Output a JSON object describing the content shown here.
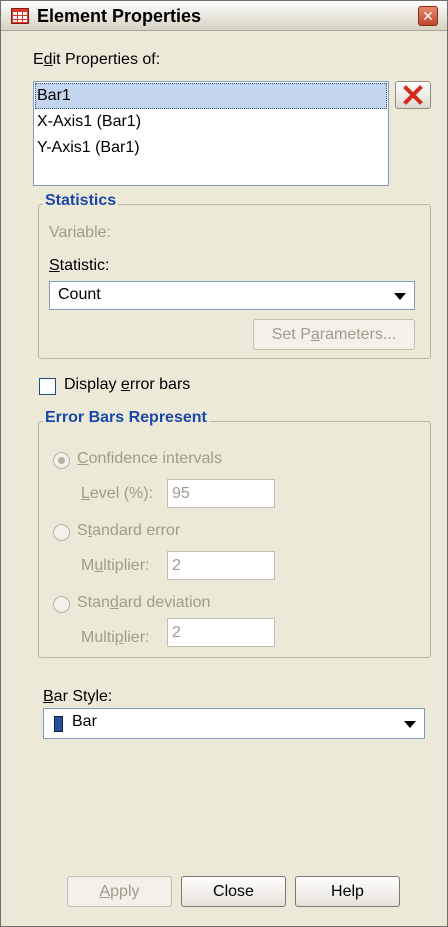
{
  "window": {
    "title": "Element Properties"
  },
  "edit_properties": {
    "label_pre": "E",
    "label_u": "d",
    "label_post": "it Properties of:",
    "items": [
      {
        "label": "Bar1",
        "selected": true
      },
      {
        "label": "X-Axis1 (Bar1)",
        "selected": false
      },
      {
        "label": "Y-Axis1 (Bar1)",
        "selected": false
      }
    ]
  },
  "statistics": {
    "group_title": "Statistics",
    "variable_label": "Variable:",
    "statistic_label_u": "S",
    "statistic_label_post": "tatistic:",
    "statistic_value": "Count",
    "set_parameters_pre": "Set P",
    "set_parameters_u": "a",
    "set_parameters_post": "rameters..."
  },
  "error_bars": {
    "checkbox_pre": "Display ",
    "checkbox_u": "e",
    "checkbox_post": "rror bars",
    "group_title": "Error Bars Represent",
    "confidence": {
      "u": "C",
      "post": "onfidence intervals",
      "field_u": "L",
      "field_post": "evel (%):",
      "value": "95"
    },
    "standard_error": {
      "pre": "S",
      "u": "t",
      "post": "andard error",
      "field_pre": "M",
      "field_u": "u",
      "field_post": "ltiplier:",
      "value": "2"
    },
    "standard_deviation": {
      "pre": "Stan",
      "u": "d",
      "post": "ard deviation",
      "field_pre": "Multi",
      "field_u": "p",
      "field_post": "lier:",
      "value": "2"
    }
  },
  "bar_style": {
    "label_u": "B",
    "label_post": "ar Style:",
    "value": "Bar",
    "swatch_color": "#2a4fa0"
  },
  "buttons": {
    "apply_u": "A",
    "apply_post": "pply",
    "close": "Close",
    "help": "Help"
  }
}
